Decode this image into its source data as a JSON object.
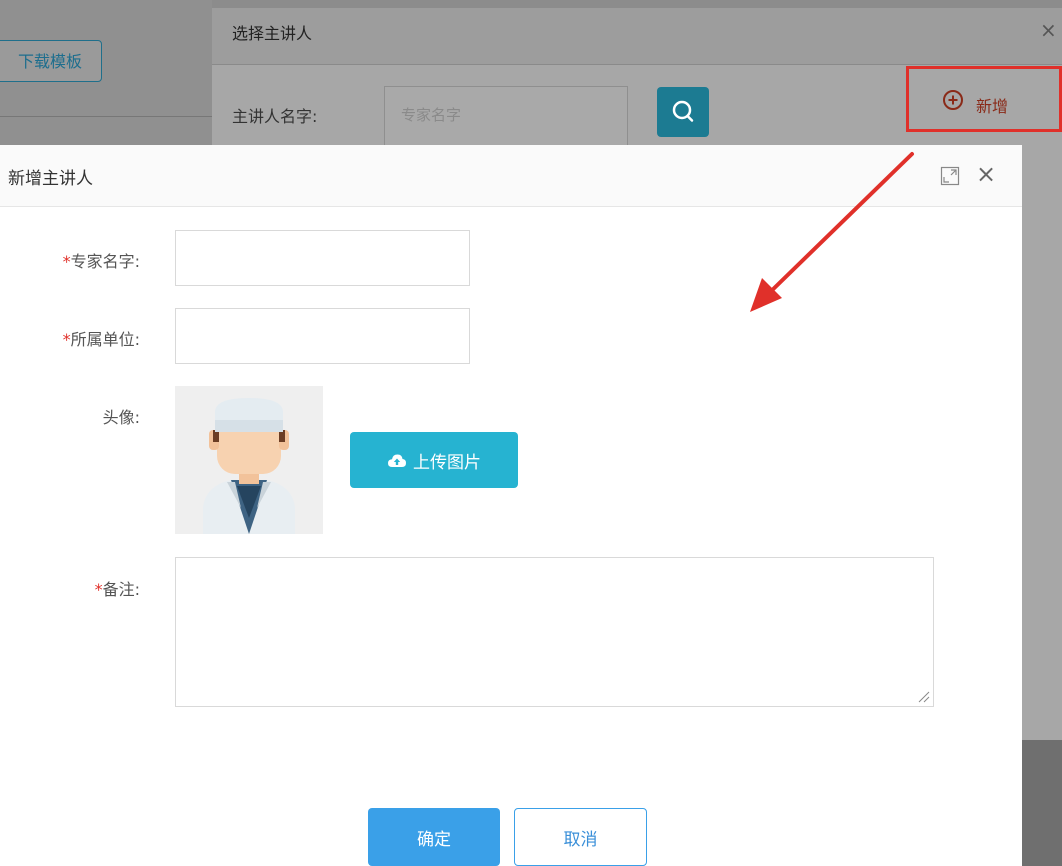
{
  "background": {
    "template_button_label": "下载模板"
  },
  "select_dialog": {
    "title": "选择主讲人",
    "close_symbol": "×",
    "name_label": "主讲人名字:",
    "name_placeholder": "专家名字",
    "search_icon": "search-icon",
    "add_label": "新增",
    "add_icon": "plus-circle-icon",
    "highlight_color": "#e0302a"
  },
  "add_dialog": {
    "title": "新增主讲人",
    "close_symbol": "×",
    "maximize_icon": "maximize-icon",
    "fields": {
      "expert_name": {
        "label": "专家名字:",
        "required_mark": "*",
        "value": ""
      },
      "organization": {
        "label": "所属单位:",
        "required_mark": "*",
        "value": ""
      },
      "avatar": {
        "label": "头像:"
      },
      "remarks": {
        "label": "备注:",
        "required_mark": "*",
        "value": ""
      }
    },
    "upload_button_label": "上传图片",
    "upload_icon": "cloud-upload-icon",
    "confirm_label": "确定",
    "cancel_label": "取消",
    "accent_color": "#26b3d1",
    "primary_color": "#3aa0e8"
  }
}
